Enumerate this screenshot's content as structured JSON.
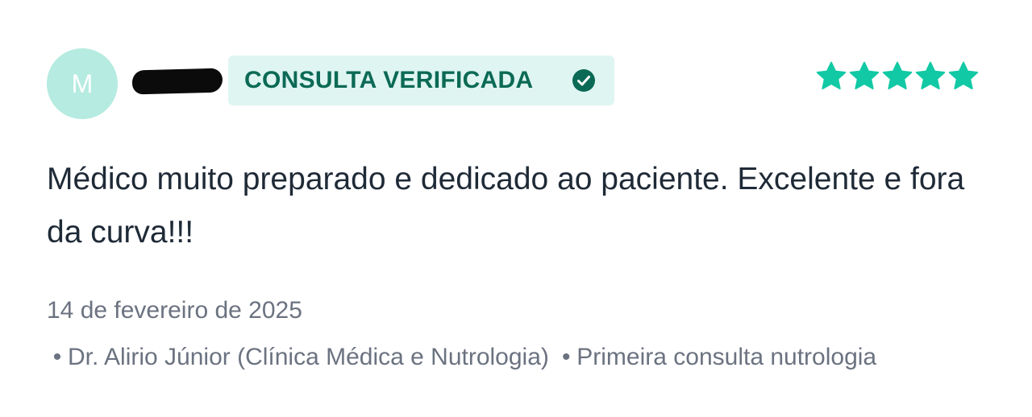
{
  "reviewer": {
    "avatar_initial": "M"
  },
  "badge": {
    "label": "CONSULTA VERIFICADA",
    "icon": "check-circle-icon"
  },
  "rating": {
    "stars": 5,
    "max": 5,
    "color": "#12c9a5"
  },
  "review": {
    "comment": "Médico muito preparado e dedicado ao paciente. Excelente e fora da curva!!!",
    "date": "14 de fevereiro de 2025",
    "bullet": "•",
    "doctor": "Dr. Alirio Júnior (Clínica Médica e Nutrologia)",
    "service": "Primeira consulta nutrologia"
  },
  "colors": {
    "avatar_bg": "#b5ebe0",
    "badge_bg": "#dff5f2",
    "badge_text": "#0b6a55",
    "body_text": "#1f2a37",
    "meta_text": "#6b7280"
  }
}
